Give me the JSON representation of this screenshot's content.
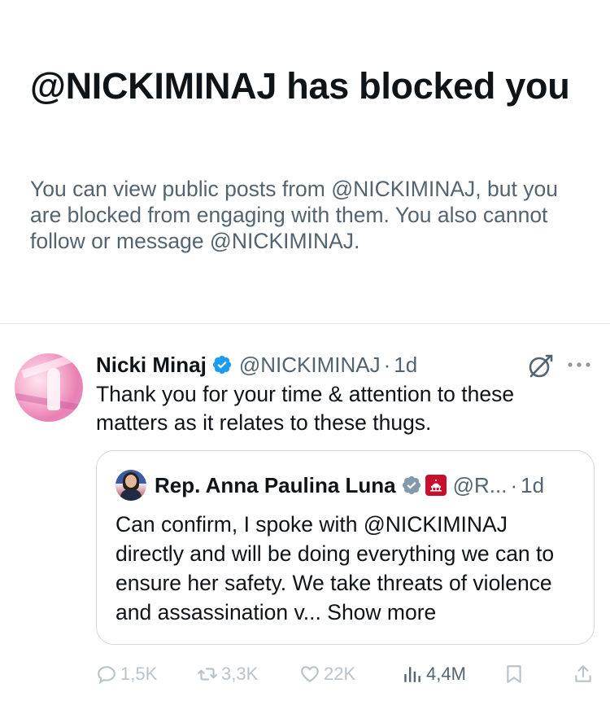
{
  "blocked": {
    "title": "@NICKIMINAJ has blocked you",
    "description": "You can view public posts from @NICKIMINAJ, but you are blocked from engaging with them. You also cannot follow or message @NICKIMINAJ."
  },
  "post": {
    "author_name": "Nicki Minaj",
    "handle": "@NICKIMINAJ",
    "separator": "·",
    "time": "1d",
    "text": "Thank you for your time & attention to these matters as it relates to these thugs.",
    "icons": {
      "verified": "verified-badge-icon",
      "grok": "grok-icon",
      "more": "more-icon"
    },
    "quote": {
      "author_name": "Rep. Anna Paulina Luna",
      "handle": "@R...",
      "separator": "·",
      "time": "1d",
      "text": "Can confirm, I spoke with @NICKIMINAJ directly and will be doing everything we can to ensure her safety. We take threats of violence and assassination v...",
      "show_more": "Show more"
    },
    "actions": {
      "replies": "1,5K",
      "reposts": "3,3K",
      "likes": "22K",
      "views": "4,4M"
    }
  },
  "colors": {
    "text_primary": "#0f1419",
    "text_secondary": "#536471",
    "verified_blue": "#1d9bf0",
    "verified_gray": "#829aab",
    "divider": "#e1e6ea"
  }
}
